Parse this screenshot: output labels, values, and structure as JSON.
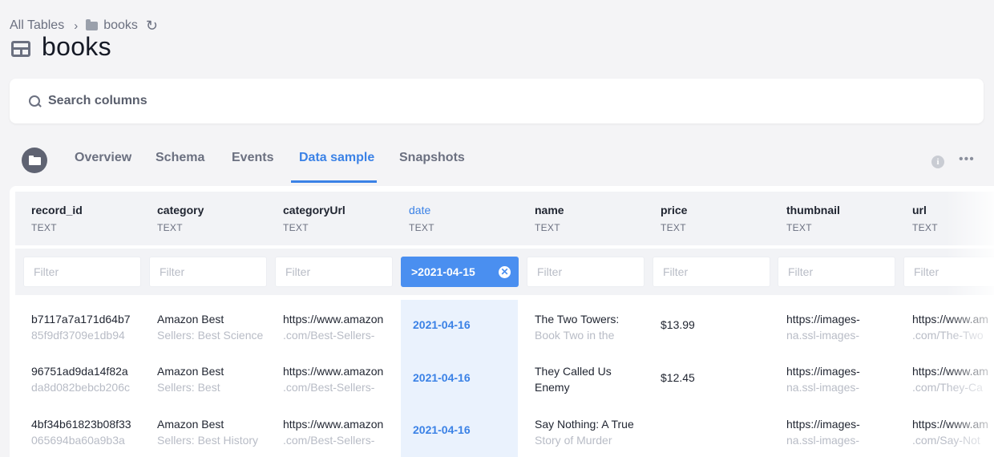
{
  "breadcrumb": {
    "root": "All Tables",
    "folder": "books"
  },
  "page_title": "books",
  "search": {
    "placeholder": "Search columns"
  },
  "tabs": [
    {
      "label": "Overview"
    },
    {
      "label": "Schema"
    },
    {
      "label": "Events"
    },
    {
      "label": "Data sample"
    },
    {
      "label": "Snapshots"
    }
  ],
  "active_tab": "Data sample",
  "info_glyph": "i",
  "more_glyph": "•••",
  "columns": [
    {
      "name": "record_id",
      "type": "TEXT"
    },
    {
      "name": "category",
      "type": "TEXT"
    },
    {
      "name": "categoryUrl",
      "type": "TEXT"
    },
    {
      "name": "date",
      "type": "TEXT"
    },
    {
      "name": "name",
      "type": "TEXT"
    },
    {
      "name": "price",
      "type": "TEXT"
    },
    {
      "name": "thumbnail",
      "type": "TEXT"
    },
    {
      "name": "url",
      "type": "TEXT"
    }
  ],
  "filter_placeholder": "Filter",
  "active_filter": {
    "column": "date",
    "value": ">2021-04-15"
  },
  "rows": [
    {
      "record_id": [
        "b7117a7a171d64b7",
        "85f9df3709e1db94"
      ],
      "category": [
        "Amazon Best",
        "Sellers: Best Science"
      ],
      "categoryUrl": [
        "https://www.amazon",
        ".com/Best-Sellers-"
      ],
      "date": "2021-04-16",
      "name": [
        "The Two Towers:",
        "Book Two in the"
      ],
      "price": "$13.99",
      "thumbnail": [
        "https://images-",
        "na.ssl-images-"
      ],
      "url": [
        "https://www.am",
        ".com/The-Two"
      ]
    },
    {
      "record_id": [
        "96751ad9da14f82a",
        "da8d082bebcb206c"
      ],
      "category": [
        "Amazon Best",
        "Sellers: Best"
      ],
      "categoryUrl": [
        "https://www.amazon",
        ".com/Best-Sellers-"
      ],
      "date": "2021-04-16",
      "name": [
        "They Called Us",
        "Enemy"
      ],
      "price": "$12.45",
      "thumbnail": [
        "https://images-",
        "na.ssl-images-"
      ],
      "url": [
        "https://www.am",
        ".com/They-Ca"
      ]
    },
    {
      "record_id": [
        "4bf34b61823b08f33",
        "065694ba60a9b3a"
      ],
      "category": [
        "Amazon Best",
        "Sellers: Best History"
      ],
      "categoryUrl": [
        "https://www.amazon",
        ".com/Best-Sellers-"
      ],
      "date": "2021-04-16",
      "name": [
        "Say Nothing: A True",
        "Story of Murder"
      ],
      "price": "",
      "thumbnail": [
        "https://images-",
        "na.ssl-images-"
      ],
      "url": [
        "https://www.am",
        ".com/Say-Not"
      ]
    }
  ]
}
